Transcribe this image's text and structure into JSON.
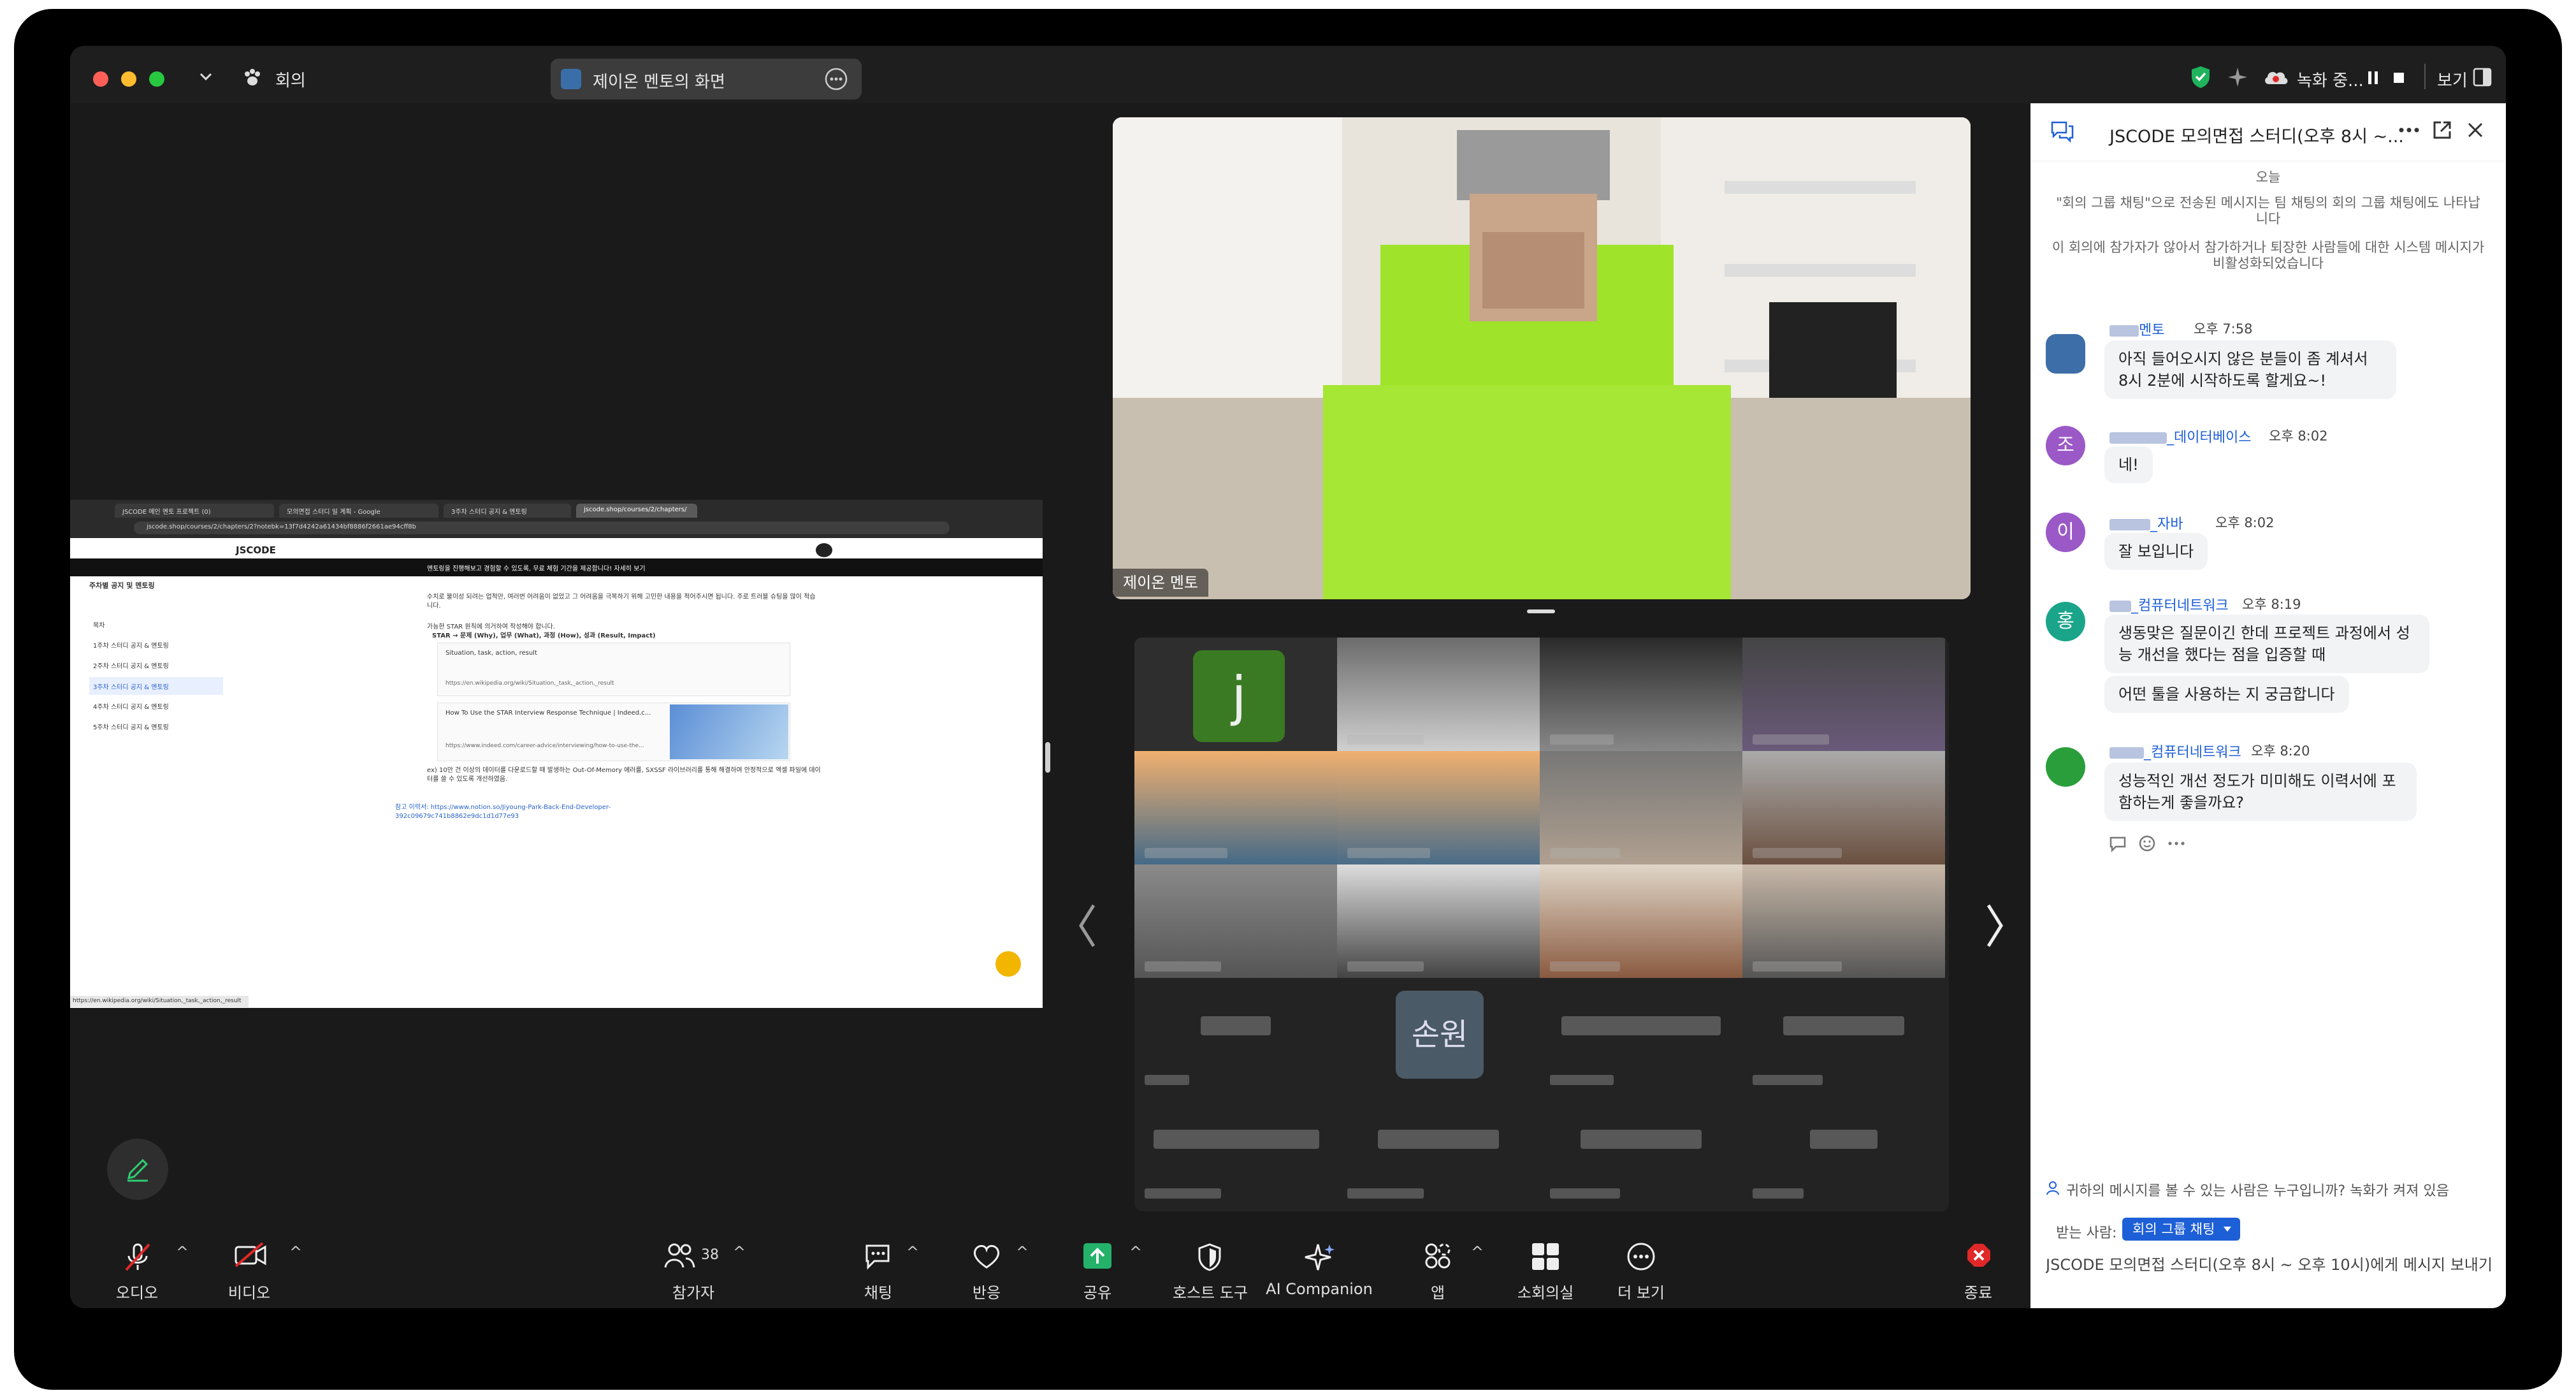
{
  "window": {
    "meeting_label": "회의",
    "share_title": "제이온 멘토의 화면",
    "recording_label": "녹화 중...",
    "view_label": "보기"
  },
  "browser": {
    "tabs": [
      "JSCODE 메인 멘토 프로젝트 (0)",
      "모의면접 스터디 일 계획 - Google",
      "3주차 스터디 공지 & 멘토링",
      "jscode.shop/courses/2/chapters/"
    ],
    "url": "jscode.shop/courses/2/chapters/2?notebk=13f7d4242a61434bf8886f2661ae94cff8b",
    "page_title": "JSCODE",
    "banner": "멘토링을 진행해보고 경험할 수 있도록, 무료 체험 기간을 제공합니다! 자세히 보기",
    "sidebar_heading": "주차별 공지 및 멘토링",
    "sidebar_items": [
      "목차",
      "1주차 스터디 공지 & 멘토링",
      "2주차 스터디 공지 & 멘토링",
      "3주차 스터디 공지 & 멘토링",
      "4주차 스터디 공지 & 멘토링",
      "5주차 스터디 공지 & 멘토링"
    ],
    "bullet1": "수치로 불이성 되려는 업적만, 여러번 어려움이 없었고 그 어려움을 극복하기 위해 고민한 내용을 적어주시면 됩니다. 주로 트러블 슈팅을 많이 적습니다.",
    "bullet2": "가능한 STAR 원칙에 의거하여 작성해야 합니다.",
    "star_line": "STAR → 문제 (Why), 업무 (What), 과정 (How), 성과 (Result, Impact)",
    "card1_title": "Situation, task, action, result",
    "card1_url": "https://en.wikipedia.org/wiki/Situation,_task,_action,_result",
    "card2_title": "How To Use the STAR Interview Response Technique | Indeed.c...",
    "card2_url": "https://www.indeed.com/career-advice/interviewing/how-to-use-the...",
    "bullet3": "ex) 10만 건 이상의 데이터를 다운로드할 때 발생하는 Out-Of-Memory 에러를, SXSSF 라이브러리를 통해 해결하여 안정적으로 엑셀 파일에 데이터를 쓸 수 있도록 개선하였음.",
    "ref_text": "참고 이력서: https://www.notion.so/Jiyoung-Park-Back-End-Developer-392c09679c741b8862e9dc1d1d77e93",
    "status_url": "https://en.wikipedia.org/wiki/Situation,_task,_action,_result"
  },
  "video": {
    "main_name": "제이온 멘토",
    "tile_initial_j": "j",
    "tile_initial_jo": "손원"
  },
  "chat": {
    "title": "JSCODE 모의면접 스터디(오후 8시 ~...",
    "date_label": "오늘",
    "system_msg1": "\"회의 그룹 채팅\"으로 전송된 메시지는 팀 채팅의 회의 그룹 채팅에도 나타납니다",
    "system_msg2": "이 회의에 참가자가 않아서 참가하거나 퇴장한 사람들에 대한 시스템 메시지가 비활성화되었습니다",
    "messages": [
      {
        "sender": "멘토",
        "time": "오후 7:58",
        "avatar": "",
        "text": "아직 들어오시지 않은 분들이 좀 계셔서 8시 2분에 시작하도록 할게요~!"
      },
      {
        "sender": "_데이터베이스",
        "time": "오후 8:02",
        "avatar": "조",
        "text": "네!"
      },
      {
        "sender": "_자바",
        "time": "오후 8:02",
        "avatar": "이",
        "text": "잘 보입니다"
      },
      {
        "sender": "_컴퓨터네트워크",
        "time": "오후 8:19",
        "avatar": "홍",
        "text": "생동맞은 질문이긴 한데 프로젝트 과정에서 성능 개선을 했다는 점을 입증할 때",
        "text2": "어떤 툴을 사용하는 지 궁금합니다"
      },
      {
        "sender": "_컴퓨터네트워크",
        "time": "오후 8:20",
        "avatar": "",
        "text": "성능적인 개선 정도가 미미해도 이력서에 포함하는게 좋을까요?"
      }
    ],
    "visibility_notice": "귀하의 메시지를 볼 수 있는 사람은 누구입니까? 녹화가 켜져 있음",
    "to_label": "받는 사람:",
    "to_value": "회의 그룹 채팅",
    "input_placeholder": "JSCODE 모의면접 스터디(오후 8시 ~ 오후 10시)에게 메시지 보내기"
  },
  "toolbar": {
    "audio": "오디오",
    "video": "비디오",
    "participants": "참가자",
    "participants_count": "38",
    "chat": "채팅",
    "reactions": "반응",
    "share": "공유",
    "host_tools": "호스트 도구",
    "ai_companion": "AI Companion",
    "apps": "앱",
    "breakout": "소회의실",
    "more": "더 보기",
    "end": "종료"
  },
  "colors": {
    "accent_blue": "#1d5fd6",
    "share_green": "#24b26b",
    "end_red": "#e02828",
    "chat_bubble": "#f2f3f5"
  }
}
